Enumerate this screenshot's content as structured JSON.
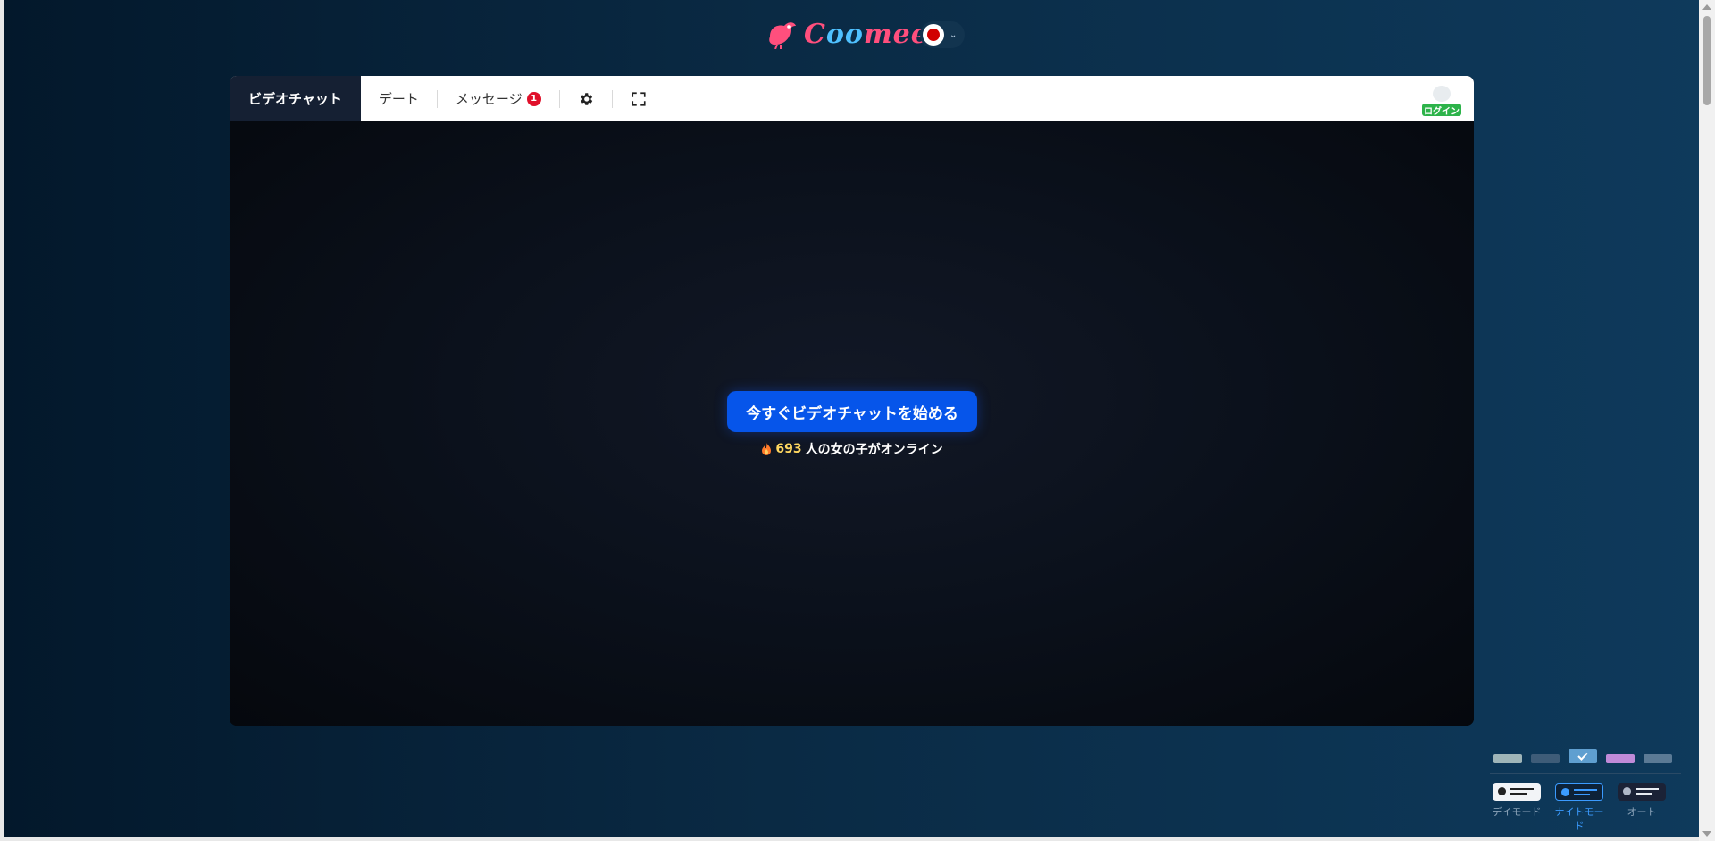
{
  "header": {
    "logo_text_a": "C",
    "logo_text_b": "oo",
    "logo_text_c": "meet",
    "language_icon": "japan-flag-icon"
  },
  "nav": {
    "tabs": [
      {
        "label": "ビデオチャット",
        "active": true
      },
      {
        "label": "デート",
        "active": false
      },
      {
        "label": "メッセージ",
        "active": false,
        "badge": "1"
      }
    ],
    "settings_icon": "gear-icon",
    "fullscreen_icon": "fullscreen-icon",
    "login_label": "ログイン"
  },
  "video": {
    "start_button_label": "今すぐビデオチャットを始める",
    "online_count": "693",
    "online_suffix": "人の女の子がオンライン"
  },
  "theme": {
    "swatches": [
      {
        "color": "#9fb5b8",
        "selected": false
      },
      {
        "color": "#3e5c78",
        "selected": false
      },
      {
        "color": "#5f9fd0",
        "selected": true
      },
      {
        "color": "#c08ad8",
        "selected": false
      },
      {
        "color": "#5b7a95",
        "selected": false
      }
    ],
    "modes": [
      {
        "label": "デイモード",
        "active": false
      },
      {
        "label": "ナイトモード",
        "active": true
      },
      {
        "label": "オート",
        "active": false
      }
    ]
  }
}
